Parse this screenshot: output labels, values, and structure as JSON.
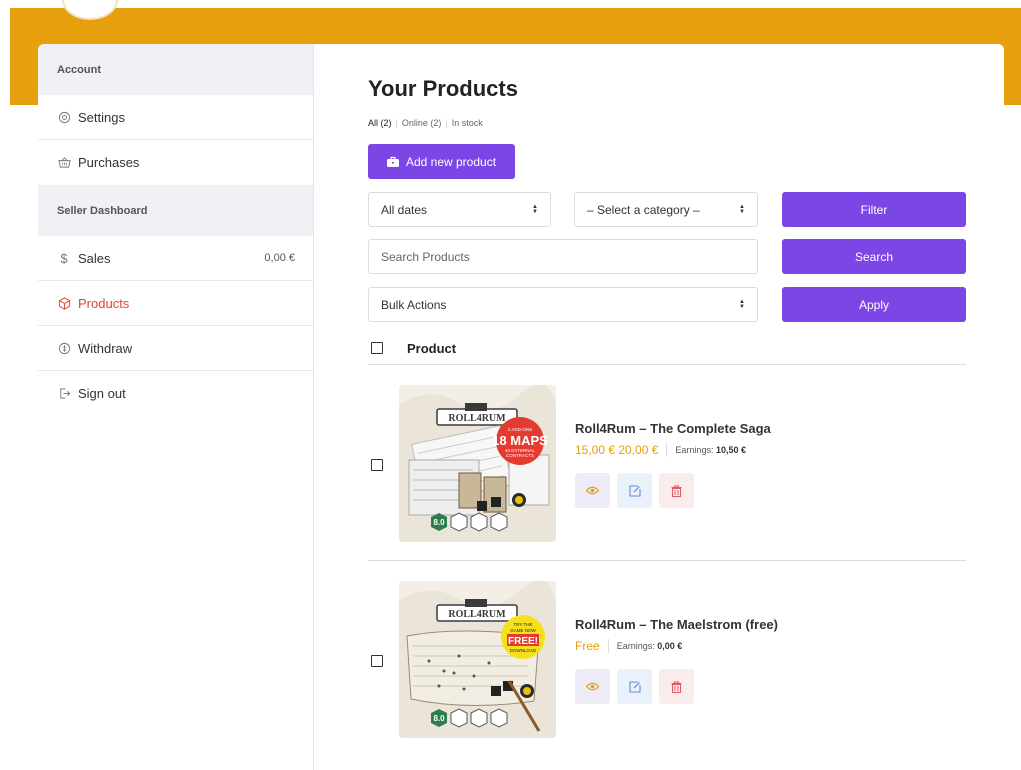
{
  "sidebar": {
    "account_heading": "Account",
    "settings_label": "Settings",
    "purchases_label": "Purchases",
    "seller_heading": "Seller Dashboard",
    "sales_label": "Sales",
    "sales_amount": "0,00 €",
    "products_label": "Products",
    "withdraw_label": "Withdraw",
    "signout_label": "Sign out"
  },
  "main": {
    "title": "Your Products",
    "subnav": {
      "all_label": "All",
      "all_count": "(2)",
      "online_label": "Online (2)",
      "instock_label": "In stock"
    },
    "add_button": "Add new product",
    "filters": {
      "dates_value": "All dates",
      "category_value": "– Select a category –",
      "filter_button": "Filter"
    },
    "search": {
      "placeholder": "Search Products",
      "button": "Search"
    },
    "bulk": {
      "value": "Bulk Actions",
      "button": "Apply"
    },
    "table": {
      "column_product": "Product",
      "rows": [
        {
          "name": "Roll4Rum – The Complete Saga",
          "price": "15,00 € 20,00 €",
          "earnings_label": "Earnings:",
          "earnings_value": "10,50 €",
          "badge_lines": [
            "2 ADD-ONS",
            "18 MAPS",
            "40 EXTERNAL",
            "CONTRACTS"
          ],
          "rating": "8.0"
        },
        {
          "name": "Roll4Rum – The Maelstrom (free)",
          "price": "Free",
          "earnings_label": "Earnings:",
          "earnings_value": "0,00 €",
          "badge_lines": [
            "TRY THE",
            "GAME NOW",
            "FREE!",
            "DOWNLOAD"
          ],
          "rating": "8.0"
        }
      ]
    }
  },
  "colors": {
    "accent_purple": "#7c45e6",
    "band_orange": "#e6a00e",
    "active_red": "#e0442b",
    "price_orange": "#e6a00e"
  },
  "icons": {
    "settings": "gear-icon",
    "purchases": "basket-icon",
    "sales": "dollar-icon",
    "products": "box-icon",
    "withdraw": "money-icon",
    "signout": "sign-out-icon",
    "add": "briefcase-icon",
    "view": "eye-icon",
    "edit": "edit-icon",
    "delete": "trash-icon"
  }
}
